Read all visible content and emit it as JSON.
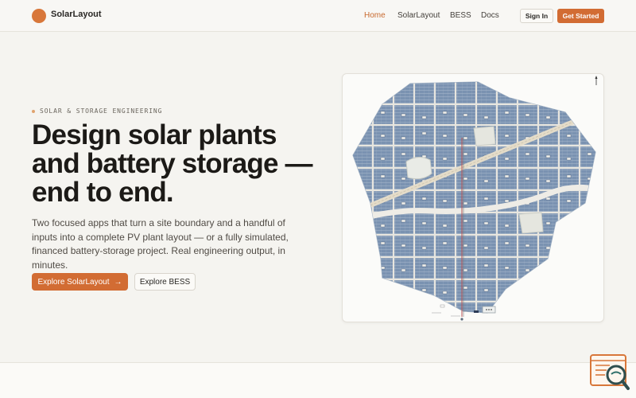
{
  "header": {
    "brand": "SolarLayout",
    "nav": [
      "Home",
      "SolarLayout",
      "BESS",
      "Docs"
    ],
    "sign_in": "Sign In",
    "get_started": "Get Started"
  },
  "hero": {
    "eyebrow": "SOLAR & STORAGE ENGINEERING",
    "headline_lines": [
      "Design solar plants",
      "and battery storage —",
      "end to end."
    ],
    "subtext": "Two focused apps that turn a site boundary and a handful of inputs into a complete PV plant layout — or a fully simulated, financed battery-storage project. Real engineering output, in minutes.",
    "primary_cta": "Explore SolarLayout",
    "primary_cta_arrow": "→",
    "secondary_cta": "Explore BESS"
  },
  "colors": {
    "accent": "#d26c33",
    "background": "#f5f4f0",
    "panel_blue": "#6e86a6"
  },
  "icons": {
    "logo": "circle-logo-icon",
    "arrow": "arrow-right-icon",
    "north": "north-arrow-icon",
    "widget": "search-document-icon"
  }
}
